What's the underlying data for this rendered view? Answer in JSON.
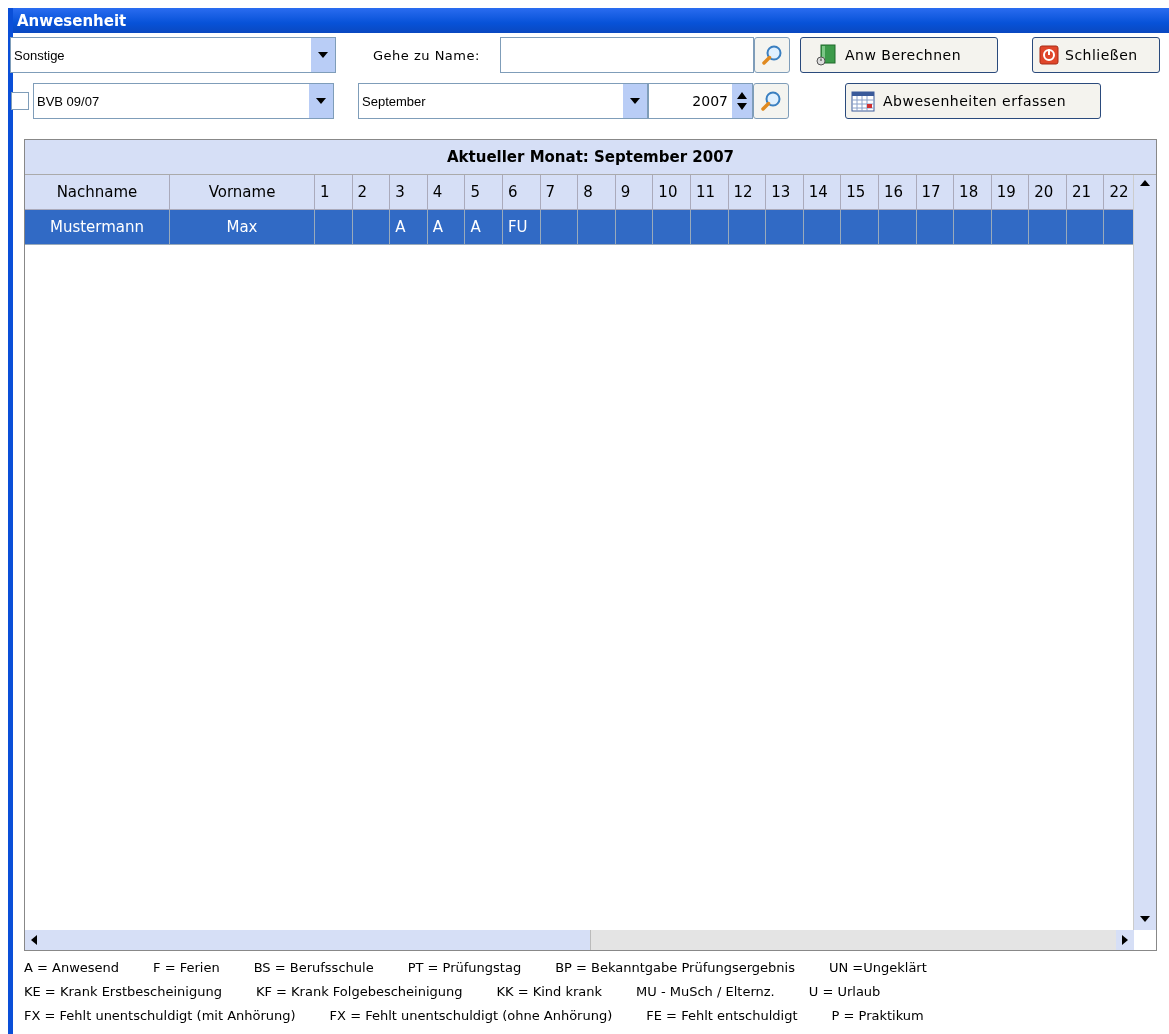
{
  "window": {
    "title": "Anwesenheit"
  },
  "filters": {
    "category": {
      "value": "Sonstige"
    },
    "goto_label": "Gehe zu Name:",
    "group_checkbox": {
      "checked": false
    },
    "group": {
      "value": "BVB 09/07"
    },
    "month": {
      "value": "September"
    },
    "year": {
      "value": "2007"
    }
  },
  "buttons": [
    {
      "kind": "calc",
      "label": "Anw Berechnen"
    },
    {
      "kind": "close",
      "label": "Schließen"
    },
    {
      "kind": "absence",
      "label": "Abwesenheiten erfassen"
    }
  ],
  "table": {
    "title": "Aktueller Monat: September 2007",
    "columns": [
      "Nachname",
      "Vorname",
      "1",
      "2",
      "3",
      "4",
      "5",
      "6",
      "7",
      "8",
      "9",
      "10",
      "11",
      "12",
      "13",
      "14",
      "15",
      "16",
      "17",
      "18",
      "19",
      "20",
      "21",
      "22"
    ],
    "rows": [
      {
        "selected": true,
        "cells": [
          "Mustermann",
          "Max",
          "",
          "",
          "A",
          "A",
          "A",
          "FU",
          "",
          "",
          "",
          "",
          "",
          "",
          "",
          "",
          "",
          "",
          "",
          "",
          "",
          "",
          "",
          ""
        ]
      }
    ]
  },
  "legend": [
    [
      "A = Anwesend",
      "F = Ferien",
      "BS = Berufsschule",
      "PT = Prüfungstag",
      "BP = Bekanntgabe Prüfungsergebnis",
      "UN =Ungeklärt"
    ],
    [
      "KE = Krank Erstbescheinigung",
      "KF = Krank Folgebescheinigung",
      "KK = Kind krank",
      "MU - MuSch / Elternz.",
      "U = Urlaub"
    ],
    [
      "FX = Fehlt unentschuldigt (mit Anhörung)",
      "FX = Fehlt unentschuldigt (ohne Anhörung)",
      "FE = Fehlt entschuldigt",
      "P = Praktikum"
    ]
  ]
}
